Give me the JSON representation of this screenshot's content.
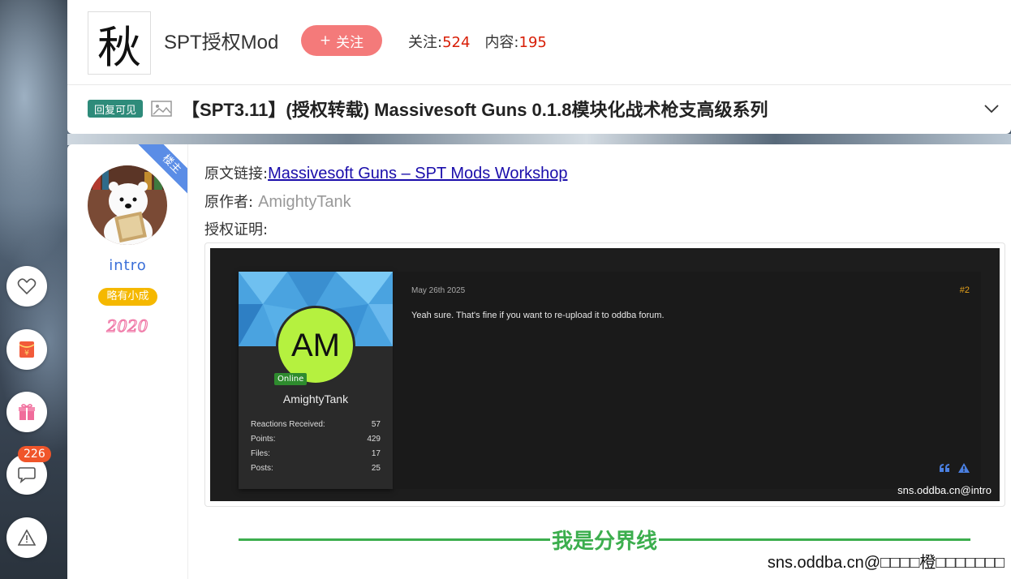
{
  "header": {
    "logo_char": "秋",
    "site_name": "SPT授权Mod",
    "follow_label": "关注",
    "follow_prefix": "+",
    "stats": {
      "follow_label": "关注:",
      "follow_count": "524",
      "content_label": "内容:",
      "content_count": "195"
    },
    "reply_badge": "回复可见",
    "post_title": "【SPT3.11】(授权转载) Massivesoft Guns 0.1.8模块化战术枪支高级系列"
  },
  "author": {
    "owner_ribbon": "楼主",
    "username": "intro",
    "rank": "略有小成",
    "medal_text": "2020"
  },
  "post": {
    "source_label": "原文链接:",
    "source_link_text": "Massivesoft Guns – SPT Mods Workshop",
    "author_label": "原作者:",
    "author_value": "AmightyTank",
    "proof_label": "授权证明:"
  },
  "proof_image": {
    "avatar_initials": "AM",
    "online": "Online",
    "name": "AmightyTank",
    "stats": [
      {
        "label": "Reactions Received:",
        "value": "57"
      },
      {
        "label": "Points:",
        "value": "429"
      },
      {
        "label": "Files:",
        "value": "17"
      },
      {
        "label": "Posts:",
        "value": "25"
      }
    ],
    "date": "May 26th 2025",
    "post_number": "#2",
    "message": "Yeah sure. That's fine if you want to re-upload it to oddba forum.",
    "watermark": "sns.oddba.cn@intro"
  },
  "separator_text": "我是分界线",
  "footer_watermark": "sns.oddba.cn@□□□□橙□□□□□□□",
  "sidebar": {
    "comment_count": "226"
  },
  "colors": {
    "follow_button": "#f47a7a",
    "count_red": "#d81e06",
    "reply_badge": "#2e8b7a",
    "username_blue": "#3a6fd8",
    "rank_badge": "#f5b800",
    "separator_green": "#3cae4e",
    "owner_ribbon": "#5b8de6"
  }
}
